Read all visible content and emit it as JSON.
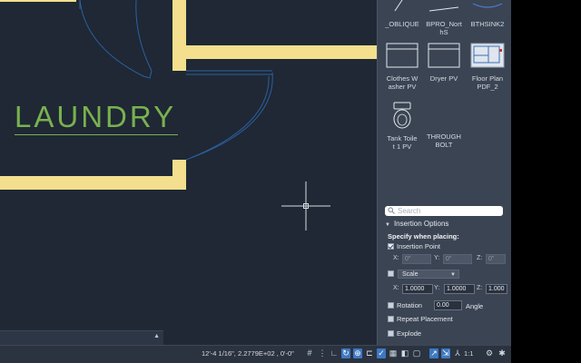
{
  "drawing": {
    "room_label": "LAUNDRY"
  },
  "palette": {
    "blocks_top": [
      {
        "label": "_OBLIQUE",
        "icon": "oblique-arrow-icon"
      },
      {
        "label": "BPRO_Nort\nhS",
        "icon": "north-arrow-icon"
      },
      {
        "label": "BTHSINK2",
        "icon": "bathroom-sink-icon"
      }
    ],
    "blocks_row2": [
      {
        "label": "Clothes W\nasher PV",
        "icon": "washer-icon"
      },
      {
        "label": "Dryer PV",
        "icon": "dryer-icon"
      },
      {
        "label": "Floor Plan\nPDF_2",
        "icon": "floor-plan-thumbnail-icon"
      }
    ],
    "blocks_row3": [
      {
        "label": "Tank Toile\nt 1 PV",
        "icon": "toilet-icon"
      },
      {
        "label": "THROUGH\nBOLT",
        "icon": "bolt-icon"
      }
    ],
    "search_placeholder": "Search",
    "insertion_options": "Insertion Options",
    "specify_when_placing": "Specify when placing:",
    "insertion_point": {
      "label": "Insertion Point",
      "checked": true,
      "x": "0\"",
      "y": "0\"",
      "z": "0\""
    },
    "scale": {
      "label": "Scale",
      "checked": false,
      "x": "1.0000",
      "y": "1.0000",
      "z": "1.000"
    },
    "rotation": {
      "label": "Rotation",
      "checked": false,
      "value": "0.00",
      "unit": "Angle"
    },
    "repeat_placement": {
      "label": "Repeat Placement",
      "checked": false
    },
    "explode": {
      "label": "Explode",
      "checked": false
    },
    "axis": {
      "x": "X:",
      "y": "Y:",
      "z": "Z:"
    }
  },
  "statusbar": {
    "coords": "12'-4 1/16\",  2.2779E+02 ,  0'-0\"",
    "annotation_scale": "1:1"
  },
  "colors": {
    "wall": "#f3df8d",
    "room_label": "#79b14f",
    "door_swing": "#2d5fa0",
    "background": "#1f2834",
    "palette_bg": "#3b4453",
    "toggle_on": "#3e78c2"
  }
}
